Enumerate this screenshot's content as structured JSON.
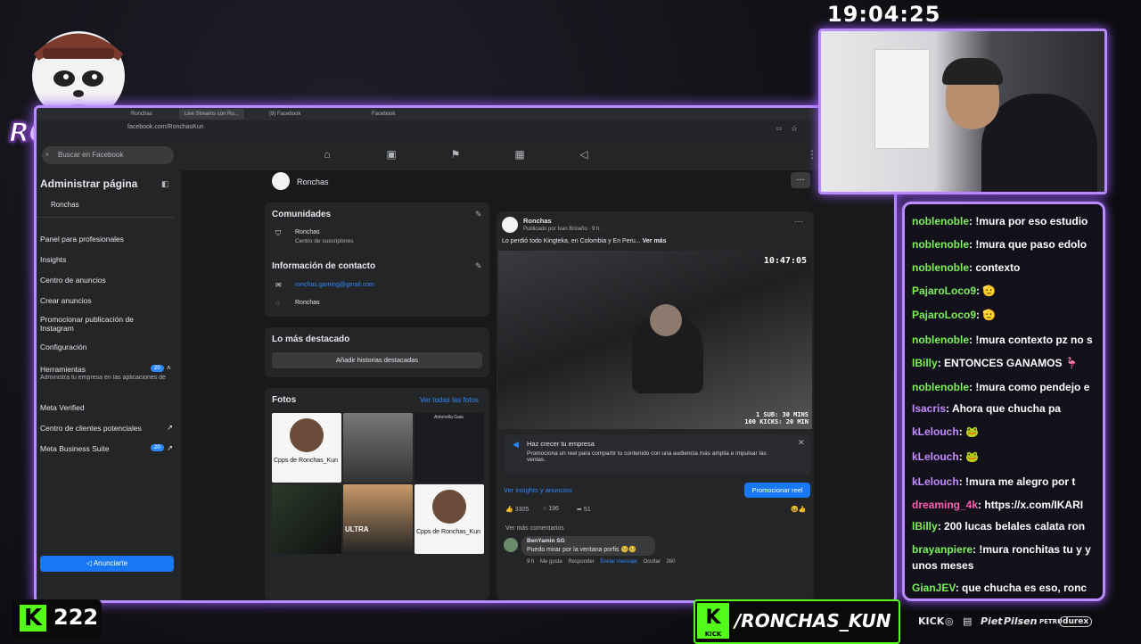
{
  "clock": "19:04:25",
  "logo": {
    "text": "RONCHAS"
  },
  "browser": {
    "tabs": [
      "Ronchas",
      "Live Streams con Ro...",
      "(9) Facebook",
      "Facebook"
    ],
    "address": "facebook.com/RonchasKun"
  },
  "facebook": {
    "search_placeholder": "Buscar en Facebook",
    "sidebar": {
      "title": "Administrar página",
      "page_name": "Ronchas",
      "items": [
        {
          "label": "Panel para profesionales"
        },
        {
          "label": "Insights"
        },
        {
          "label": "Centro de anuncios"
        },
        {
          "label": "Crear anuncios"
        },
        {
          "label": "Promocionar publicación de Instagram"
        },
        {
          "label": "Configuración"
        },
        {
          "label": "Herramientas",
          "badge": "20",
          "sub": "Administra tu empresa en las aplicaciones de"
        },
        {
          "label": "Meta Verified"
        },
        {
          "label": "Centro de clientes potenciales"
        },
        {
          "label": "Meta Business Suite",
          "badge": "20"
        }
      ],
      "advertise_button": "Anunciarte"
    },
    "page_header": {
      "name": "Ronchas"
    },
    "communities": {
      "title": "Comunidades",
      "name": "Ronchas",
      "sub": "Centro de suscriptores"
    },
    "contact": {
      "title": "Información de contacto",
      "email": "ronchas.gaming@gmail.com",
      "messenger": "Ronchas"
    },
    "highlights": {
      "title": "Lo más destacado",
      "button": "Añadir historias destacadas"
    },
    "photos": {
      "title": "Fotos",
      "see_all": "Ver todas las fotos",
      "items": [
        {
          "caption": "Cpps de Ronchas_Kun"
        },
        {
          "caption": ""
        },
        {
          "caption": "Antonella Gaia"
        },
        {
          "caption": ""
        },
        {
          "caption": "ULTRA"
        },
        {
          "caption": "Cpps de Ronchas_Kun"
        }
      ]
    },
    "post": {
      "author": "Ronchas",
      "meta": "Publicado por Ivan Briceño · 9 h ·",
      "text": "Lo perdió todo Kingteka, en Colombia y En Peru...",
      "see_more": "Ver más",
      "video_time": "10:47:05",
      "video_sub_line1": "1 SUB: 30 MINS",
      "video_sub_line2": "100 KICKS: 20 MIN",
      "promo_title": "Haz crecer tu empresa",
      "promo_text": "Promociona un reel para compartir tu contenido con una audiencia más amplia e impulsar las ventas.",
      "insights_link": "Ver insights y anuncios",
      "promote_button": "Promocionar reel",
      "likes": "3305",
      "comments": "196",
      "shares": "51",
      "more_comments": "Ver más comentarios",
      "comment": {
        "author": "BenYamin SG",
        "text": "Puedo mirar por la ventana porfis 🥺🥺",
        "time": "9 h",
        "like": "Me gusta",
        "reply": "Responder",
        "send": "Enviar mensaje",
        "hide": "Ocultar",
        "reactions": "260"
      }
    }
  },
  "chat": [
    {
      "user": "noblenoble",
      "text": "!mura por eso estudio",
      "color": "#7cf05a"
    },
    {
      "user": "noblenoble",
      "text": "!mura que paso edolo",
      "color": "#7cf05a"
    },
    {
      "user": "noblenoble",
      "text": "contexto",
      "color": "#7cf05a"
    },
    {
      "user": "PajaroLoco9",
      "text": "🫡",
      "color": "#7cf05a"
    },
    {
      "user": "PajaroLoco9",
      "text": "🫡",
      "color": "#7cf05a"
    },
    {
      "user": "noblenoble",
      "text": "!mura contexto pz no s",
      "color": "#7cf05a"
    },
    {
      "user": "lBilly",
      "text": "ENTONCES GANAMOS 🦩",
      "color": "#7cf05a"
    },
    {
      "user": "noblenoble",
      "text": "!mura como pendejo e",
      "color": "#7cf05a"
    },
    {
      "user": "Isacris",
      "text": "Ahora que chucha pa",
      "color": "#c58bff"
    },
    {
      "user": "kLelouch",
      "text": "🐸",
      "color": "#c58bff"
    },
    {
      "user": "kLelouch",
      "text": "🐸",
      "color": "#c58bff"
    },
    {
      "user": "kLelouch",
      "text": "!mura me alegro por t",
      "color": "#c58bff"
    },
    {
      "user": "dreaming_4k",
      "text": "https://x.com/IKARI",
      "color": "#ff5fb2"
    },
    {
      "user": "lBilly",
      "text": "200 lucas belales calata ron",
      "color": "#7cf05a"
    },
    {
      "user": "brayanpiere",
      "text": "!mura ronchitas tu y y",
      "color": "#7cf05a"
    },
    {
      "user": "",
      "text": "unos meses",
      "color": "#7cf05a"
    },
    {
      "user": "GianJEV",
      "text": "que chucha es eso, ronc",
      "color": "#7cf05a"
    }
  ],
  "kick_count": "222",
  "kick_label": "KICK",
  "handle": "/RONCHAS_KUN",
  "sponsors": [
    "KICK",
    "Piet",
    "Pilsen",
    "PETRU",
    "durex"
  ]
}
